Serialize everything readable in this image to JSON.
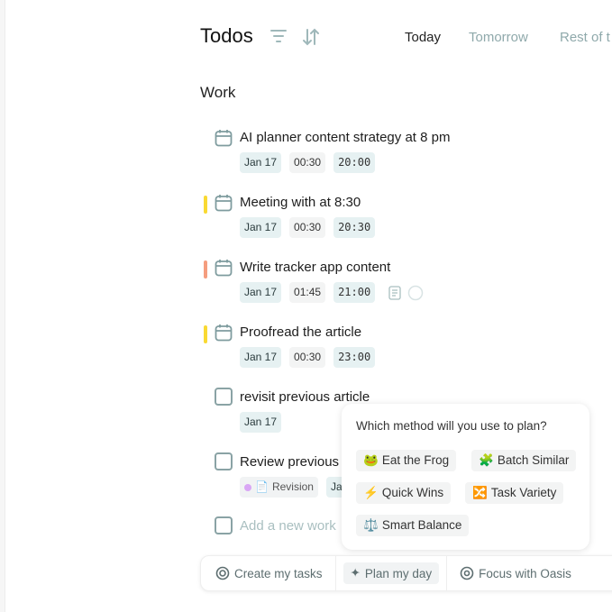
{
  "header": {
    "title": "Todos",
    "filter_icon": "filter-icon",
    "sort_icon": "sort-icon",
    "tabs": [
      {
        "label": "Today",
        "active": true
      },
      {
        "label": "Tomorrow"
      },
      {
        "label": "Rest of t"
      }
    ]
  },
  "section": {
    "title": "Work"
  },
  "tasks": [
    {
      "title": "AI planner content strategy at 8 pm",
      "icon": "calendar-icon",
      "date": "Jan 17",
      "duration": "00:30",
      "time": "20:00"
    },
    {
      "title": "Meeting with at 8:30",
      "icon": "calendar-icon",
      "priority_color": "#f9d933",
      "date": "Jan 17",
      "duration": "00:30",
      "time": "20:30"
    },
    {
      "title": "Write tracker app content",
      "icon": "calendar-icon",
      "priority_color": "#f59d7e",
      "date": "Jan 17",
      "duration": "01:45",
      "time": "21:00"
    },
    {
      "title": "Proofread the article",
      "icon": "calendar-icon",
      "priority_color": "#f9d933",
      "date": "Jan 17",
      "duration": "00:30",
      "time": "23:00"
    },
    {
      "title": "revisit previous article",
      "icon": "checkbox",
      "date": "Jan 17"
    },
    {
      "title": "Review previous",
      "icon": "checkbox",
      "tag": "Revision",
      "tag_color": "#d9a6f5",
      "date": "Jan"
    }
  ],
  "add_task": {
    "placeholder": "Add a new work"
  },
  "popup": {
    "question": "Which method will you use to plan?",
    "options": [
      {
        "emoji": "🐸",
        "label": "Eat the Frog"
      },
      {
        "emoji": "🧩",
        "label": "Batch Similar"
      },
      {
        "emoji": "⚡",
        "label": "Quick Wins"
      },
      {
        "emoji": "🔀",
        "label": "Task Variety"
      },
      {
        "emoji": "⚖️",
        "label": "Smart Balance"
      }
    ]
  },
  "bottom_bar": [
    {
      "label": "Create my tasks",
      "icon": "target-icon"
    },
    {
      "label": "Plan my day",
      "icon": "sparkle-icon",
      "active": true
    },
    {
      "label": "Focus with Oasis",
      "icon": "oasis-icon"
    }
  ]
}
